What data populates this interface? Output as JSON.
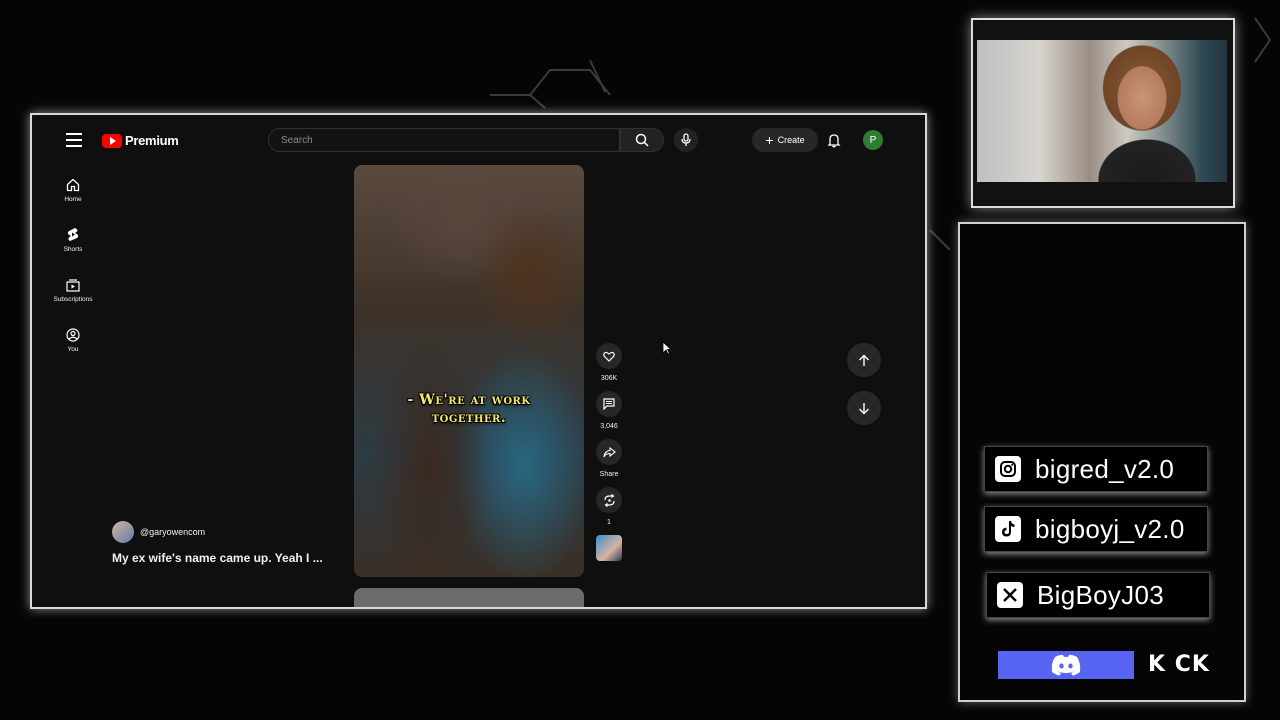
{
  "youtube": {
    "logo_text": "Premium",
    "search_placeholder": "Search",
    "create_label": "Create",
    "account_initial": "P",
    "sidebar": [
      {
        "label": "Home",
        "icon": "home-icon"
      },
      {
        "label": "Shorts",
        "icon": "shorts-icon"
      },
      {
        "label": "Subscriptions",
        "icon": "subscriptions-icon"
      },
      {
        "label": "You",
        "icon": "you-icon"
      }
    ],
    "short": {
      "subtitle_line1": "- We're at work",
      "subtitle_line2": "together.",
      "channel": "@garyowencom",
      "title": "My ex wife's name came up. Yeah I ..."
    },
    "actions": {
      "likes": "306K",
      "comments": "3,046",
      "share": "Share",
      "remix": "1"
    },
    "colors": {
      "brand_red": "#ff0000",
      "background": "#0f0f0f",
      "button_bg": "#272727",
      "avatar_green": "#2e7d32"
    }
  },
  "overlay": {
    "socials": [
      {
        "platform": "instagram",
        "icon": "instagram-icon",
        "handle": "bigred_v2.0"
      },
      {
        "platform": "tiktok",
        "icon": "tiktok-icon",
        "handle": "bigboyj_v2.0"
      },
      {
        "platform": "x",
        "icon": "x-icon",
        "handle": "BigBoyJ03"
      }
    ],
    "kick_label": "K CK",
    "colors": {
      "discord": "#5865f2"
    }
  }
}
